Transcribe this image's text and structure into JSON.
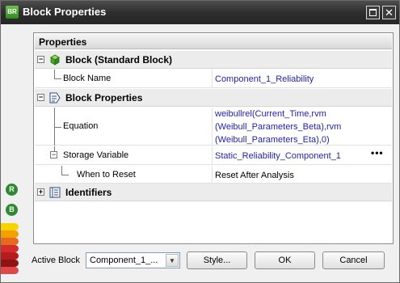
{
  "window": {
    "title": "Block Properties",
    "app_icon_text": "BR",
    "close_glyph": "✕"
  },
  "props": {
    "header": "Properties",
    "categories": [
      {
        "toggle": "−",
        "icon": "green-cube-icon",
        "label": "Block (Standard Block)"
      },
      {
        "toggle": "−",
        "icon": "block-properties-icon",
        "label": "Block Properties"
      },
      {
        "toggle": "+",
        "icon": "identifiers-icon",
        "label": "Identifiers"
      }
    ],
    "rows": {
      "block_name": {
        "name": "Block Name",
        "value": "Component_1_Reliability"
      },
      "equation": {
        "name": "Equation",
        "value_lines": [
          "weibullrel(Current_Time,rvm",
          "(Weibull_Parameters_Beta),rvm",
          "(Weibull_Parameters_Eta),0)"
        ]
      },
      "storage_variable": {
        "name": "Storage Variable",
        "value": "Static_Reliability_Component_1",
        "ellipsis": "•••",
        "toggle": "−"
      },
      "when_to_reset": {
        "name": "When to Reset",
        "value": "Reset After Analysis"
      }
    }
  },
  "side_strip": {
    "icons": [
      {
        "name": "r-badge-icon",
        "glyph": "R"
      },
      {
        "name": "b-badge-icon",
        "glyph": "B"
      }
    ],
    "colors": [
      "#f5d400",
      "#f2a100",
      "#e86a1e",
      "#d42b2b",
      "#b51c1c",
      "#8e1313",
      "#e04848"
    ]
  },
  "footer": {
    "active_block_label": "Active Block",
    "active_block_value": "Component_1_...",
    "combo_arrow": "▼",
    "style_button": "Style...",
    "ok_button": "OK",
    "cancel_button": "Cancel"
  }
}
